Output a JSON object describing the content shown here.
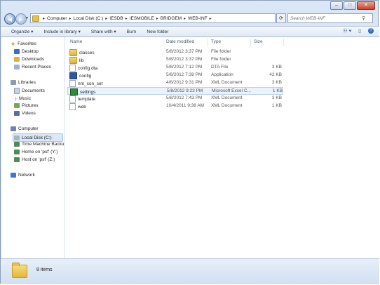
{
  "window": {
    "minimize": "–",
    "maximize": "□",
    "close": "✕"
  },
  "nav": {
    "back": "◀",
    "forward": "▶",
    "history": "▾"
  },
  "breadcrumb": [
    {
      "label": "Computer"
    },
    {
      "label": "Local Disk (C:)"
    },
    {
      "label": "IESDB"
    },
    {
      "label": "IESMOBILE"
    },
    {
      "label": "BRIDGEM"
    },
    {
      "label": "WEB-INF"
    }
  ],
  "search": {
    "placeholder": "Search WEB-INF"
  },
  "toolbar": {
    "organize": "Organize ▾",
    "include": "Include in library ▾",
    "share": "Share with ▾",
    "burn": "Burn",
    "new_folder": "New folder"
  },
  "sidebar": {
    "favorites": "Favorites",
    "desktop": "Desktop",
    "downloads": "Downloads",
    "recent": "Recent Places",
    "libraries": "Libraries",
    "documents": "Documents",
    "music": "Music",
    "pictures": "Pictures",
    "videos": "Videos",
    "computer": "Computer",
    "local_disk": "Local Disk (C:)",
    "time_machine": "Time Machine Backu",
    "home_psf": "Home on 'psf' (Y:)",
    "host_psf": "Host on 'psf' (Z:)",
    "network": "Network"
  },
  "columns": {
    "name": "Name",
    "date": "Date modified",
    "type": "Type",
    "size": "Size"
  },
  "files": [
    {
      "name": "classes",
      "date": "5/8/2012 3:37 PM",
      "type": "File folder",
      "size": "",
      "icon": "folder-icon"
    },
    {
      "name": "lib",
      "date": "5/8/2012 3:37 PM",
      "type": "File folder",
      "size": "",
      "icon": "folder-icon"
    },
    {
      "name": "config.dta",
      "date": "5/8/2012 7:12 PM",
      "type": "DTA File",
      "size": "3 KB",
      "icon": "file-icon"
    },
    {
      "name": "config",
      "date": "5/6/2012 7:39 PM",
      "type": "Application",
      "size": "42 KB",
      "icon": "app-icon"
    },
    {
      "name": "nm_con_set",
      "date": "4/6/2012 9:31 PM",
      "type": "XML Document",
      "size": "3 KB",
      "icon": "xml-icon"
    },
    {
      "name": "settings",
      "date": "5/8/2012 9:23 PM",
      "type": "Microsoft Excel C...",
      "size": "1 KB",
      "icon": "excel-icon"
    },
    {
      "name": "template",
      "date": "5/8/2012 7:43 PM",
      "type": "XML Document",
      "size": "3 KB",
      "icon": "xml-icon"
    },
    {
      "name": "web",
      "date": "10/4/2011 9:38 AM",
      "type": "XML Document",
      "size": "1 KB",
      "icon": "xml-icon"
    }
  ],
  "status": {
    "count": "8 items"
  }
}
